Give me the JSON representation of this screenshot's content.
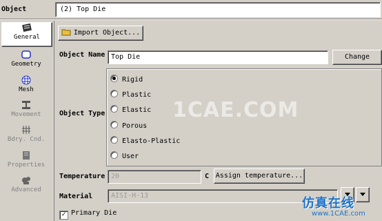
{
  "header": {
    "label": "Object",
    "value": "(2) Top Die"
  },
  "sidebar": {
    "items": [
      {
        "label": "General",
        "icon": "general-icon",
        "active": true
      },
      {
        "label": "Geometry",
        "icon": "geometry-icon"
      },
      {
        "label": "Mesh",
        "icon": "mesh-icon"
      },
      {
        "label": "Movement",
        "icon": "movement-icon"
      },
      {
        "label": "Bdry. Cnd.",
        "icon": "boundary-condition-icon"
      },
      {
        "label": "Properties",
        "icon": "properties-icon"
      },
      {
        "label": "Advanced",
        "icon": "advanced-icon"
      }
    ]
  },
  "import_button": {
    "label": "Import Object..."
  },
  "object_name": {
    "label": "Object Name",
    "value": "Top Die",
    "change_label": "Change"
  },
  "object_type": {
    "label": "Object Type",
    "options": [
      "Rigid",
      "Plastic",
      "Elastic",
      "Porous",
      "Elasto-Plastic",
      "User"
    ],
    "selected": "Rigid"
  },
  "temperature": {
    "label": "Temperature",
    "value": "20",
    "unit": "C",
    "assign_label": "Assign temperature..."
  },
  "material": {
    "label": "Material",
    "value": "AISI-H-13"
  },
  "primary_die": {
    "label": "Primary Die",
    "checked": true
  },
  "watermark": {
    "center": "1CAE.COM",
    "brand": "仿真在线",
    "url": "www.1CAE.com"
  },
  "colors": {
    "panel": "#d4d0c8",
    "highlight": "#ffffff",
    "watermark": "#1e73c8"
  }
}
